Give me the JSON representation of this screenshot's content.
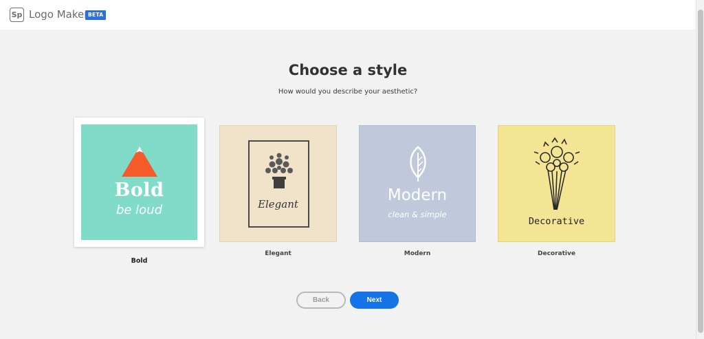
{
  "header": {
    "logo_mark": "Sp",
    "app_name": "Logo Maker",
    "badge": "BETA",
    "brand_color": "#2d6fdb"
  },
  "main": {
    "title": "Choose a style",
    "subtitle": "How would you describe your aesthetic?"
  },
  "styles": [
    {
      "label": "Bold",
      "tile_text": "Bold",
      "tile_subtext": "be loud",
      "icon": "mountain-icon",
      "bg_color": "#80dbc9",
      "selected": true
    },
    {
      "label": "Elegant",
      "tile_text": "Elegant",
      "icon": "potted-plant-icon",
      "bg_color": "#f0e3c9",
      "selected": false
    },
    {
      "label": "Modern",
      "tile_text": "Modern",
      "tile_subtext": "clean & simple",
      "icon": "leaf-icon",
      "bg_color": "#bfc9db",
      "selected": false
    },
    {
      "label": "Decorative",
      "tile_text": "Decorative",
      "icon": "flower-bouquet-icon",
      "bg_color": "#f4e594",
      "selected": false
    }
  ],
  "nav": {
    "back_label": "Back",
    "next_label": "Next",
    "accent_color": "#1473e6"
  }
}
